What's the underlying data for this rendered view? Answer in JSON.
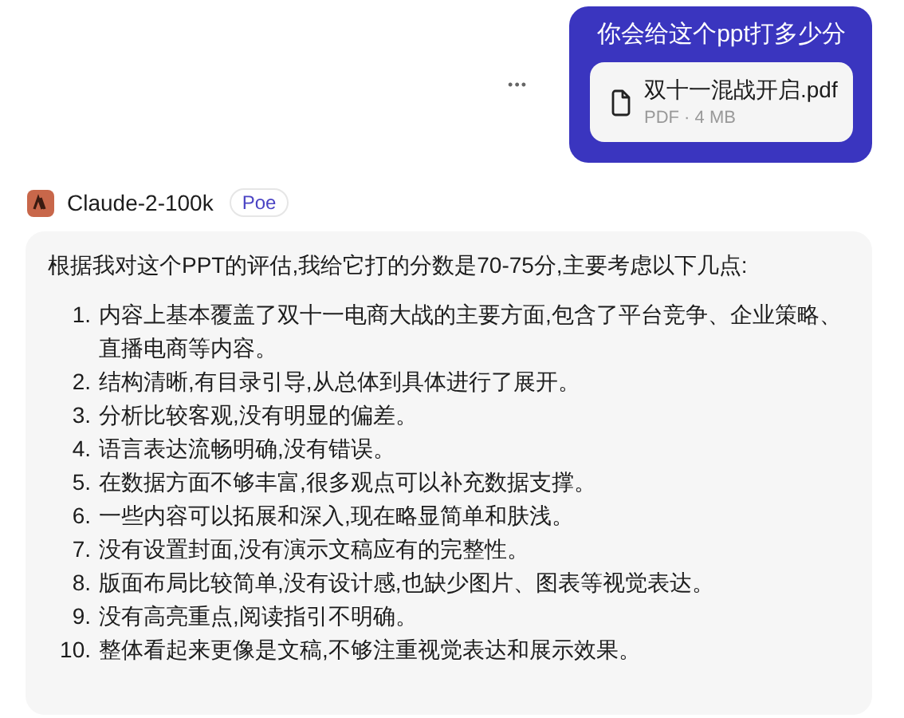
{
  "user_message": {
    "text": "你会给这个ppt打多少分",
    "attachment": {
      "name": "双十一混战开启.pdf",
      "meta": "PDF · 4 MB"
    }
  },
  "more_menu": "•••",
  "bot": {
    "name": "Claude-2-100k",
    "badge": "Poe"
  },
  "reply": {
    "intro": "根据我对这个PPT的评估,我给它打的分数是70-75分,主要考虑以下几点:",
    "points": [
      {
        "number": "1.",
        "text": "内容上基本覆盖了双十一电商大战的主要方面,包含了平台竞争、企业策略、直播电商等内容。"
      },
      {
        "number": "2.",
        "text": "结构清晰,有目录引导,从总体到具体进行了展开。"
      },
      {
        "number": "3.",
        "text": "分析比较客观,没有明显的偏差。"
      },
      {
        "number": "4.",
        "text": "语言表达流畅明确,没有错误。"
      },
      {
        "number": "5.",
        "text": "在数据方面不够丰富,很多观点可以补充数据支撑。"
      },
      {
        "number": "6.",
        "text": "一些内容可以拓展和深入,现在略显简单和肤浅。"
      },
      {
        "number": "7.",
        "text": "没有设置封面,没有演示文稿应有的完整性。"
      },
      {
        "number": "8.",
        "text": "版面布局比较简单,没有设计感,也缺少图片、图表等视觉表达。"
      },
      {
        "number": "9.",
        "text": "没有高亮重点,阅读指引不明确。"
      },
      {
        "number": "10.",
        "text": "整体看起来更像是文稿,不够注重视觉表达和展示效果。"
      }
    ]
  }
}
